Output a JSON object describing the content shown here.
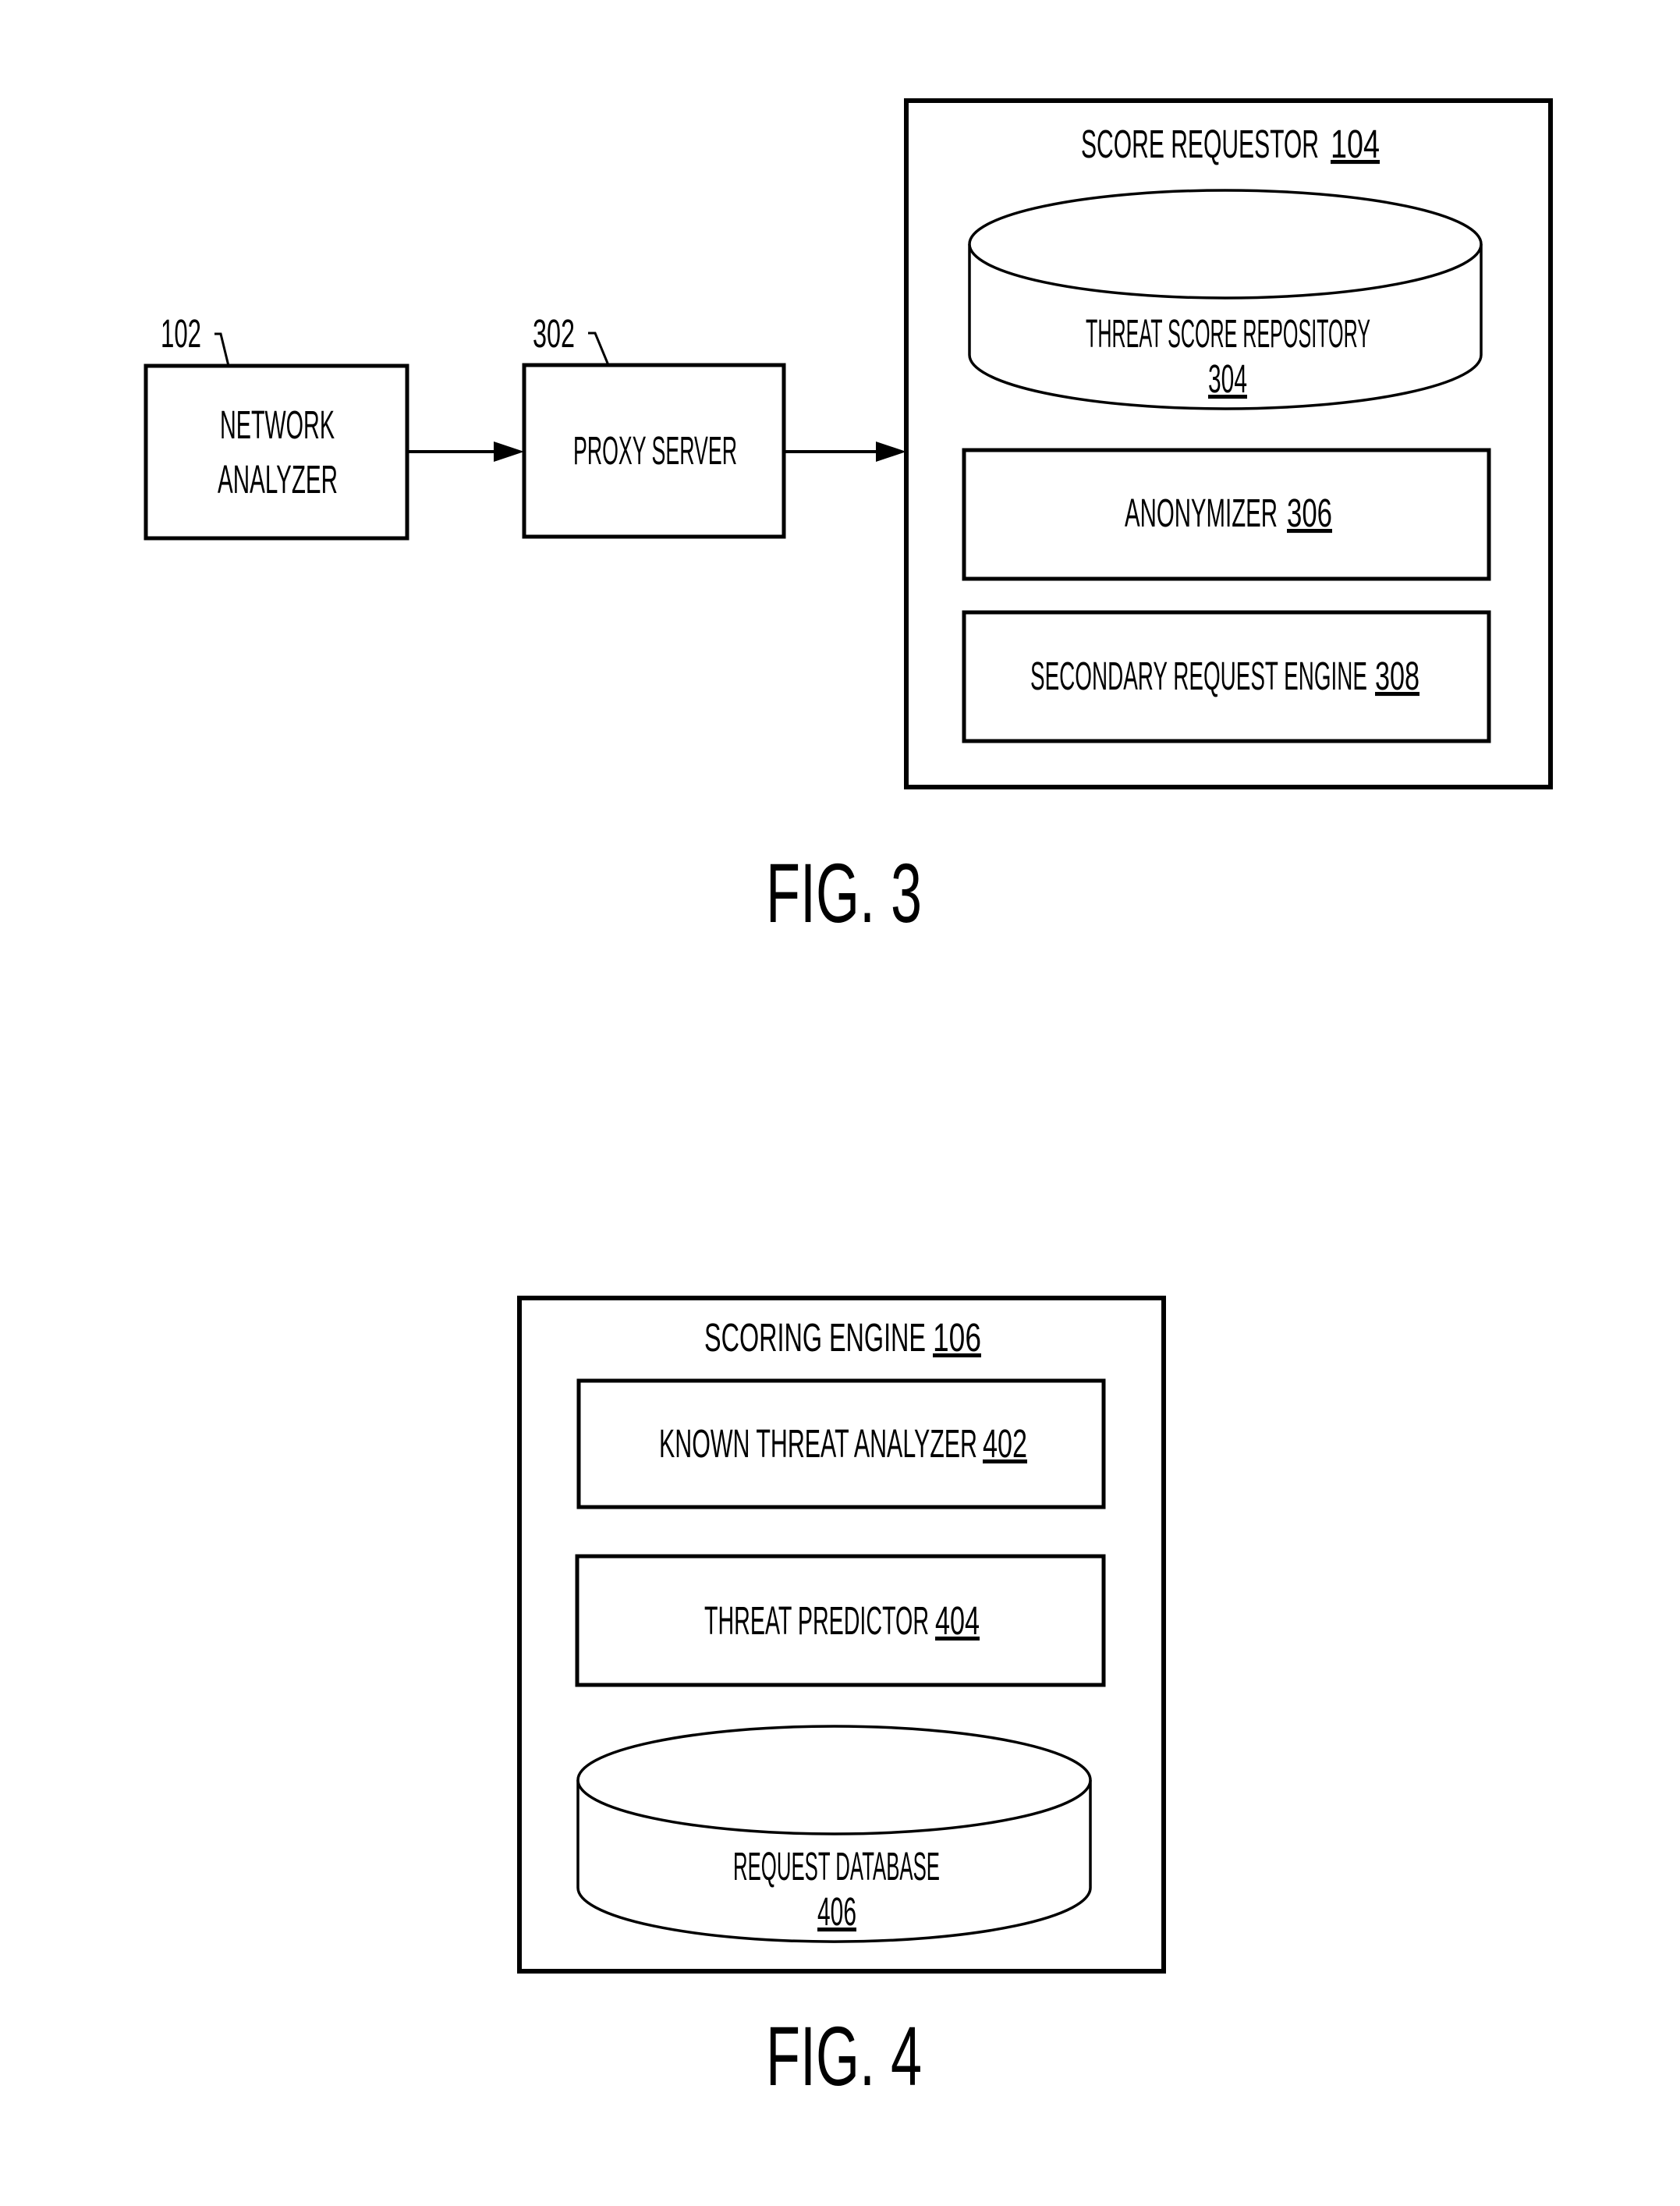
{
  "figures": [
    {
      "caption": "FIG. 3",
      "nodes": {
        "network_analyzer": {
          "ref": "102",
          "line1": "NETWORK",
          "line2": "ANALYZER"
        },
        "proxy_server": {
          "ref": "302",
          "label": "PROXY SERVER"
        },
        "score_requestor": {
          "label": "SCORE REQUESTOR",
          "num": "104",
          "children": {
            "threat_score_repository": {
              "label": "THREAT SCORE REPOSITORY",
              "num": "304",
              "shape": "cylinder"
            },
            "anonymizer": {
              "label": "ANONYMIZER",
              "num": "306"
            },
            "secondary_request_engine": {
              "label": "SECONDARY REQUEST ENGINE",
              "num": "308"
            }
          }
        }
      },
      "edges": [
        {
          "from": "network_analyzer",
          "to": "proxy_server"
        },
        {
          "from": "proxy_server",
          "to": "score_requestor"
        }
      ]
    },
    {
      "caption": "FIG. 4",
      "nodes": {
        "scoring_engine": {
          "label": "SCORING ENGINE",
          "num": "106",
          "children": {
            "known_threat_analyzer": {
              "label": "KNOWN THREAT ANALYZER",
              "num": "402"
            },
            "threat_predictor": {
              "label": "THREAT PREDICTOR",
              "num": "404"
            },
            "request_database": {
              "label": "REQUEST DATABASE",
              "num": "406",
              "shape": "cylinder"
            }
          }
        }
      },
      "edges": []
    }
  ],
  "colors": {
    "ink": "#000000",
    "paper": "#ffffff"
  }
}
